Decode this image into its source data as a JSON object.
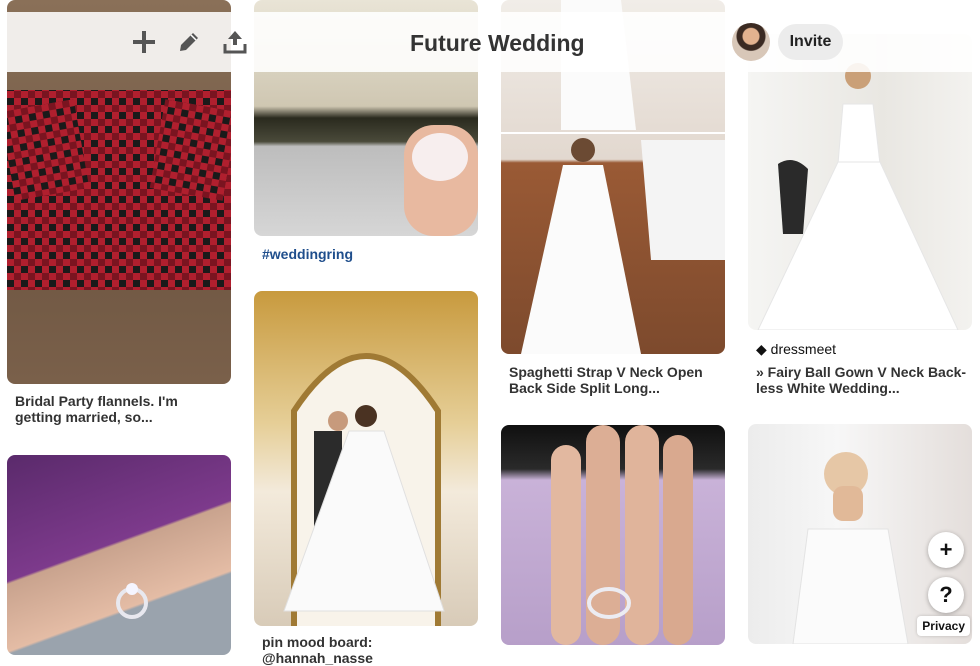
{
  "board": {
    "title": "Future Wedding",
    "invite_label": "Invite"
  },
  "toolbar": {
    "add_icon": "plus-icon",
    "edit_icon": "pencil-icon",
    "share_icon": "upload-icon"
  },
  "pins": {
    "flannels": {
      "caption": "Bridal Party flannels. I'm getting married, so..."
    },
    "ring_box": {
      "hashtag": "#weddingring"
    },
    "v_neck_dress": {
      "caption": "Spaghetti Strap V Neck Open Back Side Split Long..."
    },
    "ball_gown": {
      "source": "dressmeet",
      "caption": "» Fairy Ball Gown V Neck Back-less White Wedding..."
    },
    "mood_board": {
      "caption": "pin mood board: @hannah_nasse"
    }
  },
  "floating": {
    "add_label": "+",
    "help_label": "?",
    "privacy_label": "Privacy"
  },
  "colors": {
    "link_blue": "#1f4e8c",
    "flannel_red": "#b01f2e",
    "background": "#ffffff"
  }
}
